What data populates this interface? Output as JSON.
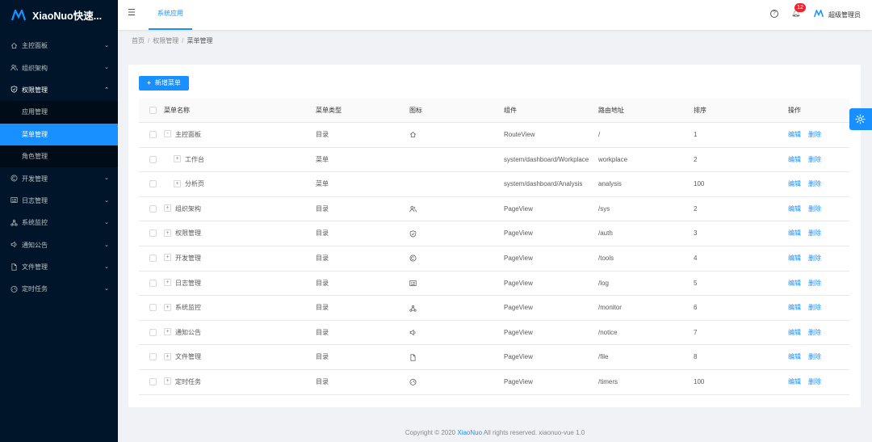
{
  "app": {
    "title": "XiaoNuo快速..."
  },
  "sidebar": {
    "items": [
      {
        "label": "主控面板",
        "icon": "home-icon"
      },
      {
        "label": "组织架构",
        "icon": "team-icon"
      },
      {
        "label": "权限管理",
        "icon": "safety-icon",
        "open": true,
        "children": [
          {
            "label": "应用管理"
          },
          {
            "label": "菜单管理",
            "selected": true
          },
          {
            "label": "角色管理"
          }
        ]
      },
      {
        "label": "开发管理",
        "icon": "copyright-icon"
      },
      {
        "label": "日志管理",
        "icon": "profile-icon"
      },
      {
        "label": "系统监控",
        "icon": "cluster-icon"
      },
      {
        "label": "通知公告",
        "icon": "sound-icon"
      },
      {
        "label": "文件管理",
        "icon": "file-icon"
      },
      {
        "label": "定时任务",
        "icon": "dashboard-icon"
      }
    ]
  },
  "header": {
    "tab": "系统应用",
    "badge": "12",
    "user": "超级管理员"
  },
  "breadcrumb": {
    "home": "首页",
    "parent": "权限管理",
    "current": "菜单管理"
  },
  "toolbar": {
    "add_label": "新增菜单"
  },
  "table": {
    "headers": {
      "name": "菜单名称",
      "type": "菜单类型",
      "icon": "图标",
      "component": "组件",
      "path": "路由地址",
      "sort": "排序",
      "op": "操作"
    },
    "edit_label": "编辑",
    "delete_label": "删除",
    "rows": [
      {
        "name": "主控面板",
        "expander": "-",
        "indent": 0,
        "type": "目录",
        "icon": "home-icon",
        "component": "RouteView",
        "path": "/",
        "sort": "1"
      },
      {
        "name": "工作台",
        "expander": "+",
        "indent": 1,
        "type": "菜单",
        "icon": "",
        "component": "system/dashboard/Workplace",
        "path": "workplace",
        "sort": "2"
      },
      {
        "name": "分析页",
        "expander": "+",
        "indent": 1,
        "type": "菜单",
        "icon": "",
        "component": "system/dashboard/Analysis",
        "path": "analysis",
        "sort": "100"
      },
      {
        "name": "组织架构",
        "expander": "+",
        "indent": 0,
        "type": "目录",
        "icon": "team-icon",
        "component": "PageView",
        "path": "/sys",
        "sort": "2"
      },
      {
        "name": "权限管理",
        "expander": "+",
        "indent": 0,
        "type": "目录",
        "icon": "safety-icon",
        "component": "PageView",
        "path": "/auth",
        "sort": "3"
      },
      {
        "name": "开发管理",
        "expander": "+",
        "indent": 0,
        "type": "目录",
        "icon": "copyright-icon",
        "component": "PageView",
        "path": "/tools",
        "sort": "4"
      },
      {
        "name": "日志管理",
        "expander": "+",
        "indent": 0,
        "type": "目录",
        "icon": "profile-icon",
        "component": "PageView",
        "path": "/log",
        "sort": "5"
      },
      {
        "name": "系统监控",
        "expander": "+",
        "indent": 0,
        "type": "目录",
        "icon": "cluster-icon",
        "component": "PageView",
        "path": "/monitor",
        "sort": "6"
      },
      {
        "name": "通知公告",
        "expander": "+",
        "indent": 0,
        "type": "目录",
        "icon": "sound-icon",
        "component": "PageView",
        "path": "/notice",
        "sort": "7"
      },
      {
        "name": "文件管理",
        "expander": "+",
        "indent": 0,
        "type": "目录",
        "icon": "file-icon",
        "component": "PageView",
        "path": "/file",
        "sort": "8"
      },
      {
        "name": "定时任务",
        "expander": "+",
        "indent": 0,
        "type": "目录",
        "icon": "dashboard-icon",
        "component": "PageView",
        "path": "/timers",
        "sort": "100"
      }
    ]
  },
  "footer": {
    "prefix": "Copyright © 2020 ",
    "brand": "XiaoNuo",
    "suffix": " All rights reserved. xiaonuo-vue 1.0"
  },
  "colors": {
    "primary": "#1890ff",
    "sider": "#001529",
    "badge": "#f5222d"
  }
}
